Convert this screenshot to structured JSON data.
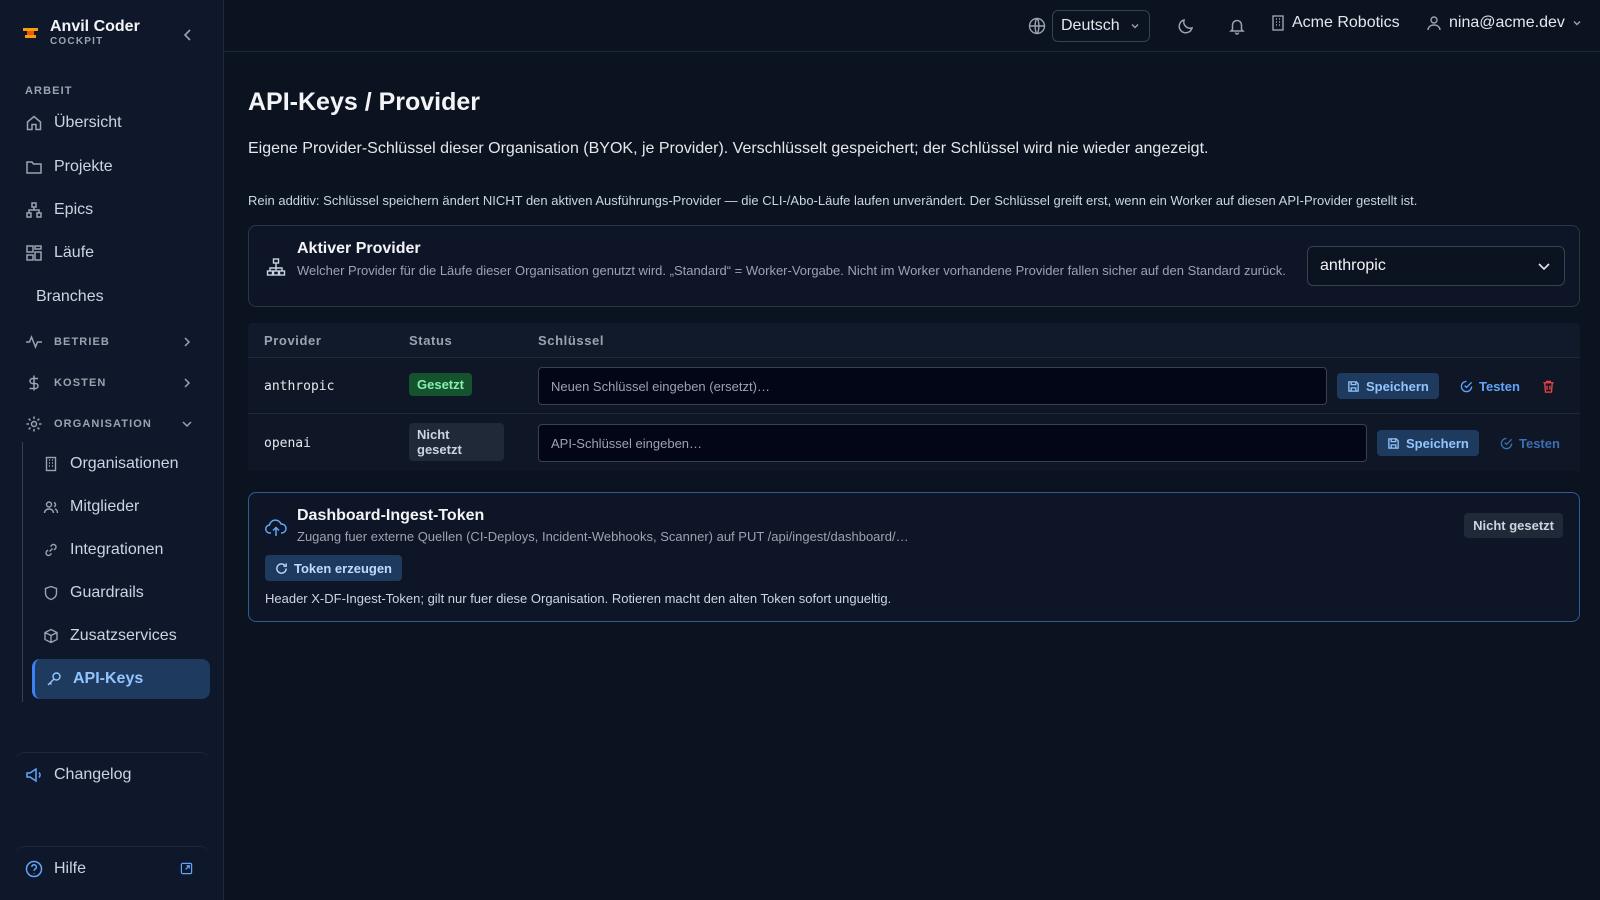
{
  "app": {
    "name": "Anvil Coder",
    "subtitle": "COCKPIT"
  },
  "sidebar": {
    "section_work": "ARBEIT",
    "items": [
      {
        "label": "Übersicht",
        "icon": "home-icon"
      },
      {
        "label": "Projekte",
        "icon": "folder-icon"
      },
      {
        "label": "Epics",
        "icon": "hierarchy-icon"
      },
      {
        "label": "Läufe",
        "icon": "grid-icon"
      },
      {
        "label": "Branches",
        "icon": ""
      }
    ],
    "groups": [
      {
        "label": "BETRIEB",
        "icon": "activity-icon",
        "expanded": false
      },
      {
        "label": "KOSTEN",
        "icon": "dollar-icon",
        "expanded": false
      },
      {
        "label": "ORGANISATION",
        "icon": "gear-icon",
        "expanded": true
      }
    ],
    "org_items": [
      {
        "label": "Organisationen",
        "icon": "building-icon"
      },
      {
        "label": "Mitglieder",
        "icon": "users-icon"
      },
      {
        "label": "Integrationen",
        "icon": "link-icon"
      },
      {
        "label": "Guardrails",
        "icon": "shield-icon"
      },
      {
        "label": "Zusatzservices",
        "icon": "box-icon"
      },
      {
        "label": "API-Keys",
        "icon": "key-icon",
        "active": true
      }
    ],
    "changelog": "Changelog",
    "help": "Hilfe"
  },
  "topbar": {
    "language": "Deutsch",
    "organization": "Acme Robotics",
    "user": "nina@acme.dev"
  },
  "page": {
    "title": "API-Keys / Provider",
    "description": "Eigene Provider-Schlüssel dieser Organisation (BYOK, je Provider). Verschlüsselt gespeichert; der Schlüssel wird nie wieder angezeigt.",
    "note": "Rein additiv: Schlüssel speichern ändert NICHT den aktiven Ausführungs-Provider — die CLI-/Abo-Läufe laufen unverändert. Der Schlüssel greift erst, wenn ein Worker auf diesen API-Provider gestellt ist."
  },
  "active_provider": {
    "title": "Aktiver Provider",
    "description": "Welcher Provider für die Läufe dieser Organisation genutzt wird. „Standard“ = Worker-Vorgabe. Nicht im Worker vorhandene Provider fallen sicher auf den Standard zurück.",
    "selected": "anthropic"
  },
  "keys_table": {
    "columns": [
      "Provider",
      "Status",
      "Schlüssel"
    ],
    "rows": [
      {
        "provider": "anthropic",
        "status": "Gesetzt",
        "placeholder": "Neuen Schlüssel eingeben (ersetzt)…",
        "save": "Speichern",
        "test": "Testen"
      },
      {
        "provider": "openai",
        "status": "Nicht gesetzt",
        "placeholder": "API-Schlüssel eingeben…",
        "save": "Speichern",
        "test": "Testen"
      }
    ]
  },
  "ingest_token": {
    "title": "Dashboard-Ingest-Token",
    "description": "Zugang fuer externe Quellen (CI-Deploys, Incident-Webhooks, Scanner) auf PUT /api/ingest/dashboard/…",
    "status": "Nicht gesetzt",
    "button": "Token erzeugen",
    "hint": "Header X-DF-Ingest-Token; gilt nur fuer diese Organisation. Rotieren macht den alten Token sofort ungueltig."
  },
  "colors": {
    "accent": "#3b82f6",
    "success": "#86efac",
    "danger": "#ef4444",
    "brand_logo": "#f59e0b"
  }
}
